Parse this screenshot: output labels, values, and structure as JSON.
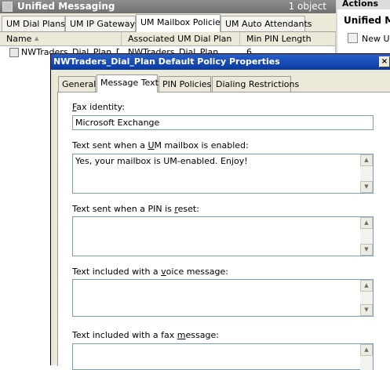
{
  "main_window": {
    "title": "Unified Messaging",
    "object_count": "1 object",
    "tabs": [
      {
        "label": "UM Dial Plans"
      },
      {
        "label": "UM IP Gateways"
      },
      {
        "label": "UM Mailbox Policies"
      },
      {
        "label": "UM Auto Attendants"
      }
    ],
    "columns": {
      "name": "Name",
      "sort_indicator": "▲",
      "associated_dial_plan": "Associated UM Dial Plan",
      "min_pin_length": "Min PIN Length"
    },
    "rows": [
      {
        "name": "NWTraders_Dial_Plan_D...",
        "dial_plan": "NWTraders_Dial_Plan",
        "min_pin": "6"
      }
    ]
  },
  "actions_pane": {
    "title": "Actions",
    "heading": "Unified Me",
    "items": [
      {
        "label": "New UM"
      }
    ]
  },
  "dialog": {
    "title": "NWTraders_Dial_Plan Default Policy Properties",
    "close": "×",
    "tabs": [
      {
        "label": "General"
      },
      {
        "label": "Message Text"
      },
      {
        "label": "PIN Policies"
      },
      {
        "label": "Dialing Restrictions"
      }
    ],
    "fields": {
      "fax_identity": {
        "pre": "",
        "key": "F",
        "post": "ax identity:",
        "value": "Microsoft Exchange"
      },
      "enabled_text": {
        "pre": "Text sent when a ",
        "key": "U",
        "post": "M mailbox is enabled:",
        "value": "Yes, your mailbox is UM-enabled. Enjoy!"
      },
      "pin_reset_text": {
        "pre": "Text sent when a PIN is ",
        "key": "r",
        "post": "eset:",
        "value": ""
      },
      "voice_message_text": {
        "pre": "Text included with a ",
        "key": "v",
        "post": "oice message:",
        "value": ""
      },
      "fax_message_text": {
        "pre": "Text included with a fax ",
        "key": "m",
        "post": "essage:",
        "value": ""
      }
    }
  }
}
